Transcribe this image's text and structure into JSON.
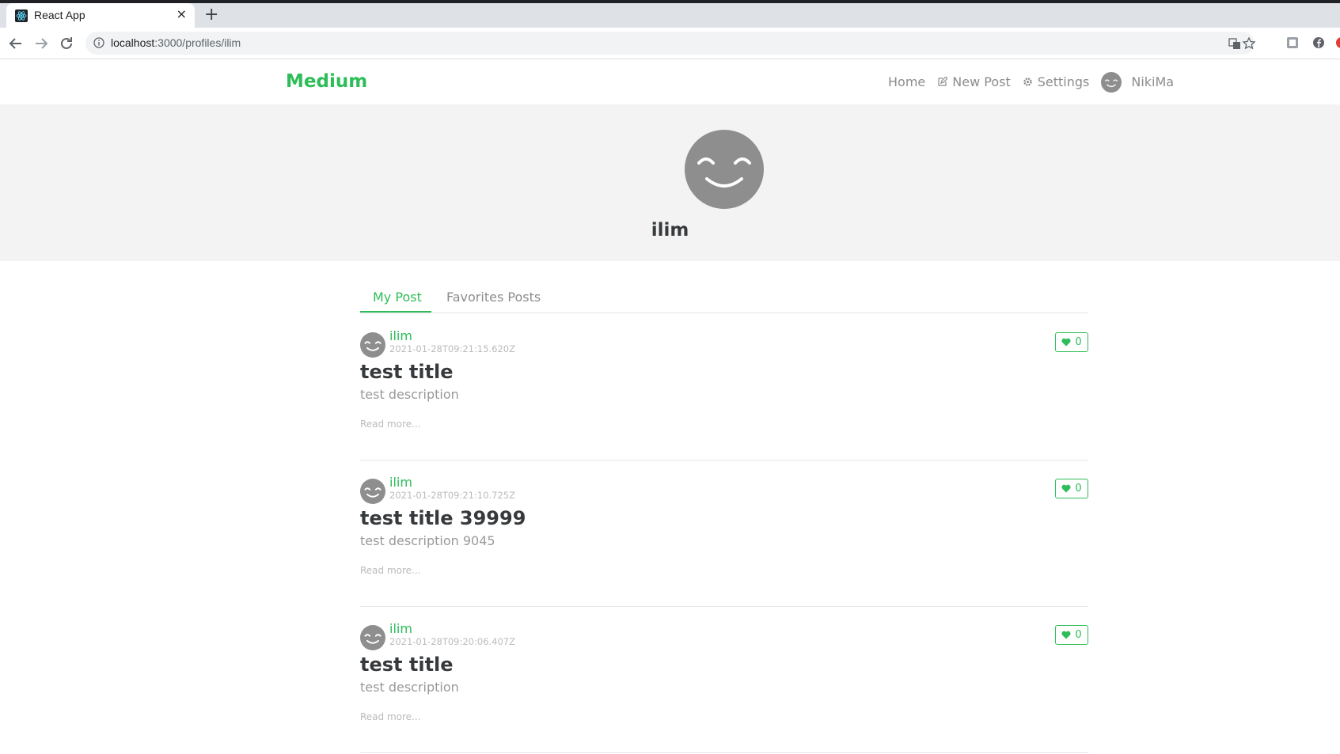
{
  "browser": {
    "tab_title": "React App",
    "tab_close": "×",
    "new_tab": "+",
    "url_host": "localhost",
    "url_path": ":3000/profiles/ilim"
  },
  "navbar": {
    "brand": "Medium",
    "links": [
      {
        "label": "Home",
        "icon": ""
      },
      {
        "label": "New Post",
        "icon": "edit-icon"
      },
      {
        "label": "Settings",
        "icon": "gear-icon"
      },
      {
        "label": "NikiMa",
        "icon": "avatar"
      }
    ]
  },
  "profile": {
    "username": "ilim"
  },
  "tabs": [
    {
      "label": "My Post",
      "active": true
    },
    {
      "label": "Favorites Posts",
      "active": false
    }
  ],
  "articles": [
    {
      "author": "ilim",
      "date": "2021-01-28T09:21:15.620Z",
      "likes": "0",
      "title": "test title",
      "description": "test description",
      "read_more": "Read more..."
    },
    {
      "author": "ilim",
      "date": "2021-01-28T09:21:10.725Z",
      "likes": "0",
      "title": "test title 39999",
      "description": "test description 9045",
      "read_more": "Read more..."
    },
    {
      "author": "ilim",
      "date": "2021-01-28T09:20:06.407Z",
      "likes": "0",
      "title": "test title",
      "description": "test description",
      "read_more": "Read more..."
    }
  ],
  "colors": {
    "accent": "#2ebd59",
    "banner_bg": "#f3f3f3",
    "avatar_gray": "#8e8e8e"
  }
}
